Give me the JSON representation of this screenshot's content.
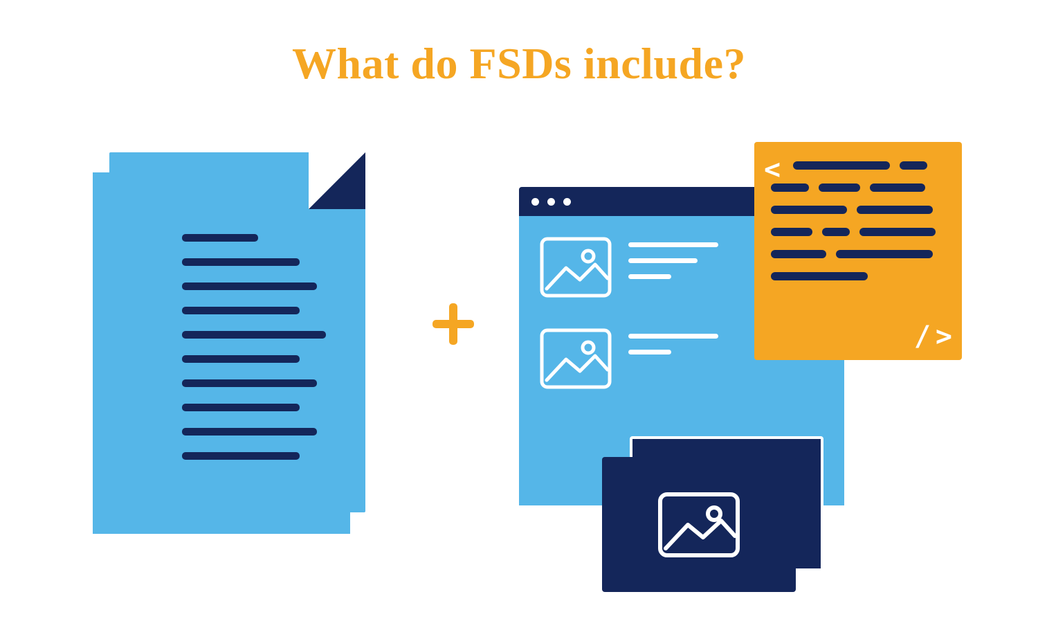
{
  "title": "What do FSDs include?",
  "colors": {
    "accent_orange": "#f5a623",
    "sky_blue": "#55b6e8",
    "navy": "#14265a",
    "white": "#ffffff"
  },
  "icons": {
    "document": "document-icon",
    "plus": "plus-icon",
    "browser": "browser-window-icon",
    "image_placeholder": "image-placeholder-icon",
    "code": "code-panel-icon",
    "photo": "photo-card-icon"
  }
}
